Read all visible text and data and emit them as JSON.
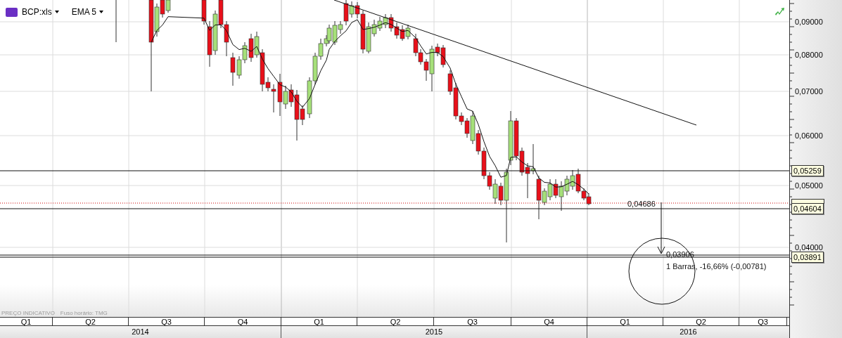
{
  "toolbar": {
    "symbol": "BCP:xls",
    "indicator": "EMA 5"
  },
  "y_axis": {
    "labels": [
      "0,09000",
      "0,08000",
      "0,07000",
      "0,06000",
      "0,05000",
      "0,04000"
    ]
  },
  "price_tags": [
    "0,05259",
    "0,04604",
    "0,03891"
  ],
  "annotations": {
    "start_value": "0,04686",
    "end_value": "0,03906",
    "measure": "1 Barras, -16,66% (-0,00781)"
  },
  "footer": {
    "note": "PREÇO INDICATIVO",
    "timezone": "Fuso horário: TMG"
  },
  "quarters": [
    "Q1",
    "Q2",
    "Q3",
    "Q4",
    "Q1",
    "Q2",
    "Q3",
    "Q4",
    "Q1",
    "Q2",
    "Q3"
  ],
  "years": [
    "2014",
    "2015",
    "2016"
  ]
}
